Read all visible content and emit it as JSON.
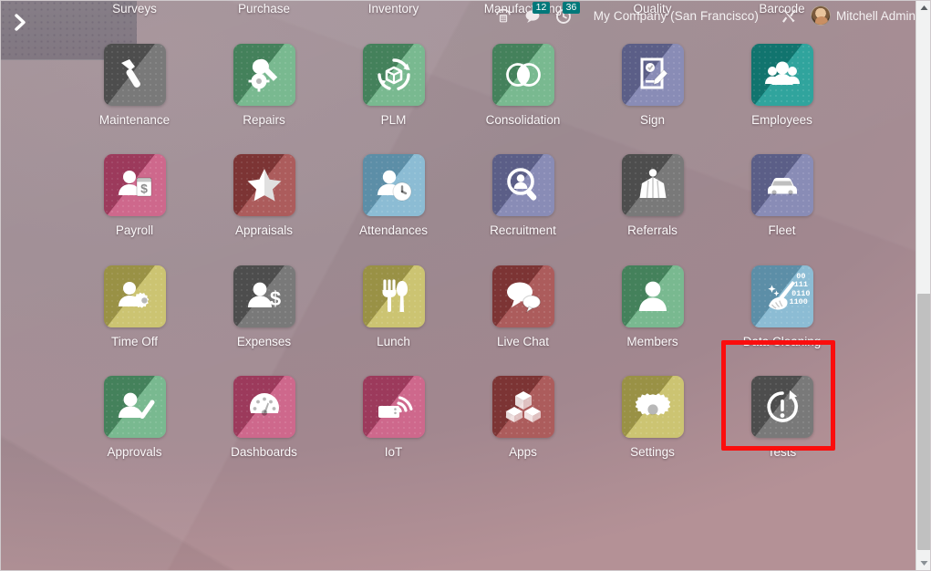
{
  "navbar": {
    "phone_icon": "phone-icon",
    "messages": {
      "icon": "chat-icon",
      "count": "12"
    },
    "activities": {
      "icon": "clock-icon",
      "count": "36"
    },
    "company": "My Company (San Francisco)",
    "tools_icon": "tools-icon",
    "user": "Mitchell Admin",
    "avatar": "user-avatar"
  },
  "sidebar": {
    "expand_icon": "chevron-right-icon"
  },
  "highlight": {
    "target": "Data Cleaning",
    "color": "#fb0d0d"
  },
  "scrollbar": {
    "up_icon": "caret-up-icon",
    "down_icon": "caret-down-icon"
  },
  "apps": [
    {
      "label": "Surveys",
      "icon": "survey-icon",
      "color": "#c58341",
      "color2": "#b06f33"
    },
    {
      "label": "Purchase",
      "icon": "purchase-icon",
      "color": "#6ba3bd",
      "color2": "#5892ad"
    },
    {
      "label": "Inventory",
      "icon": "inventory-icon",
      "color": "#a34a4a",
      "color2": "#8e3c3c"
    },
    {
      "label": "Manufacturing",
      "icon": "manufacturing-icon",
      "color": "#6ab183",
      "color2": "#4e9468"
    },
    {
      "label": "Quality",
      "icon": "quality-icon",
      "color": "#7fb5cf",
      "color2": "#6aa3c0"
    },
    {
      "label": "Barcode",
      "icon": "barcode-icon",
      "color": "#7c7fae",
      "color2": "#686c9b"
    },
    {
      "label": "Maintenance",
      "icon": "maintenance-icon",
      "color": "#6a6a6a",
      "color2": "#585858"
    },
    {
      "label": "Repairs",
      "icon": "repairs-icon",
      "color": "#6ab183",
      "color2": "#4e9468"
    },
    {
      "label": "PLM",
      "icon": "plm-icon",
      "color": "#6ab183",
      "color2": "#4e9468"
    },
    {
      "label": "Consolidation",
      "icon": "consolidation-icon",
      "color": "#6ab183",
      "color2": "#4e9468"
    },
    {
      "label": "Sign",
      "icon": "sign-icon",
      "color": "#7c7fae",
      "color2": "#686c9b"
    },
    {
      "label": "Employees",
      "icon": "employees-icon",
      "color": "#199a92",
      "color2": "#13857e"
    },
    {
      "label": "Payroll",
      "icon": "payroll-icon",
      "color": "#c8577f",
      "color2": "#b34269"
    },
    {
      "label": "Appraisals",
      "icon": "appraisals-icon",
      "color": "#a34a4a",
      "color2": "#8e3c3c"
    },
    {
      "label": "Attendances",
      "icon": "attendances-icon",
      "color": "#7fb5cf",
      "color2": "#6aa3c0"
    },
    {
      "label": "Recruitment",
      "icon": "recruitment-icon",
      "color": "#7c7fae",
      "color2": "#686c9b"
    },
    {
      "label": "Referrals",
      "icon": "referrals-icon",
      "color": "#6a6a6a",
      "color2": "#585858"
    },
    {
      "label": "Fleet",
      "icon": "fleet-icon",
      "color": "#7c7fae",
      "color2": "#686c9b"
    },
    {
      "label": "Time Off",
      "icon": "timeoff-icon",
      "color": "#c6bd62",
      "color2": "#b0a64f"
    },
    {
      "label": "Expenses",
      "icon": "expenses-icon",
      "color": "#6a6a6a",
      "color2": "#585858"
    },
    {
      "label": "Lunch",
      "icon": "lunch-icon",
      "color": "#c6bd62",
      "color2": "#b0a64f"
    },
    {
      "label": "Live Chat",
      "icon": "livechat-icon",
      "color": "#a34a4a",
      "color2": "#8e3c3c"
    },
    {
      "label": "Members",
      "icon": "members-icon",
      "color": "#6ab183",
      "color2": "#4e9468"
    },
    {
      "label": "Data Cleaning",
      "icon": "datacleaning-icon",
      "color": "#7fb5cf",
      "color2": "#6aa3c0",
      "binary": [
        "00",
        "111",
        "0110",
        "1100"
      ]
    },
    {
      "label": "Approvals",
      "icon": "approvals-icon",
      "color": "#6ab183",
      "color2": "#4e9468"
    },
    {
      "label": "Dashboards",
      "icon": "dashboards-icon",
      "color": "#c8577f",
      "color2": "#b34269"
    },
    {
      "label": "IoT",
      "icon": "iot-icon",
      "color": "#c8577f",
      "color2": "#b34269"
    },
    {
      "label": "Apps",
      "icon": "apps-icon",
      "color": "#a34a4a",
      "color2": "#8e3c3c"
    },
    {
      "label": "Settings",
      "icon": "settings-icon",
      "color": "#c6bd62",
      "color2": "#b0a64f"
    },
    {
      "label": "Tests",
      "icon": "tests-icon",
      "color": "#6a6a6a",
      "color2": "#585858"
    }
  ]
}
